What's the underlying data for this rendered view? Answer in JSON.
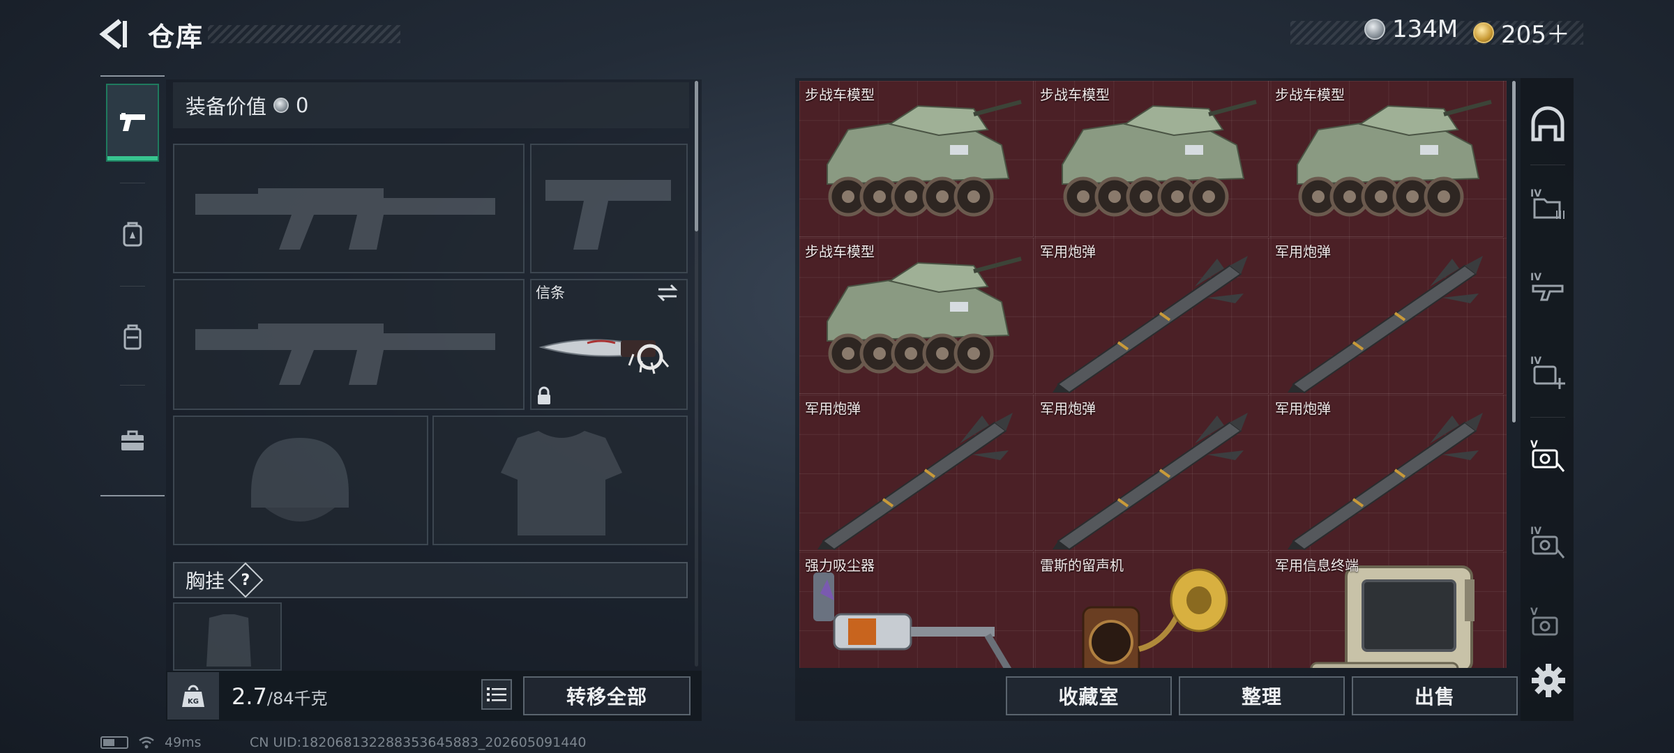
{
  "header": {
    "title": "仓库",
    "currency": [
      {
        "icon": "silver-coin-icon",
        "value": "134M"
      },
      {
        "icon": "gold-coin-icon",
        "value": "205＋"
      }
    ]
  },
  "left_rail": {
    "tabs": [
      {
        "icon": "pistol-icon",
        "active": true
      },
      {
        "icon": "backpack-icon",
        "active": false
      },
      {
        "icon": "rig-icon",
        "active": false
      },
      {
        "icon": "toolbox-icon",
        "active": false
      }
    ]
  },
  "loadout": {
    "value_label": "装备价值",
    "value": "0",
    "melee_label": "信条",
    "chest_label": "胸挂",
    "help": "?"
  },
  "footer_left": {
    "weight_current": "2.7",
    "weight_max": "/84千克",
    "weight_icon_text": "KG",
    "transfer_all": "转移全部"
  },
  "storage": {
    "items": [
      {
        "name": "步战车模型",
        "kind": "vehicle"
      },
      {
        "name": "步战车模型",
        "kind": "vehicle"
      },
      {
        "name": "步战车模型",
        "kind": "vehicle"
      },
      {
        "name": "步战车模型",
        "kind": "vehicle"
      },
      {
        "name": "军用炮弹",
        "kind": "missile"
      },
      {
        "name": "军用炮弹",
        "kind": "missile"
      },
      {
        "name": "军用炮弹",
        "kind": "missile"
      },
      {
        "name": "军用炮弹",
        "kind": "missile"
      },
      {
        "name": "军用炮弹",
        "kind": "missile"
      },
      {
        "name": "强力吸尘器",
        "kind": "vacuum"
      },
      {
        "name": "雷斯的留声机",
        "kind": "gramophone"
      },
      {
        "name": "军用信息终端",
        "kind": "terminal"
      }
    ],
    "cell_color": "#4b2026"
  },
  "footer_right": {
    "collection": "收藏室",
    "sort": "整理",
    "sell": "出售"
  },
  "status": {
    "ping": "49ms",
    "uid": "CN UID:18206813228835364588​3_202605091440"
  },
  "colors": {
    "accent_green": "#38c590",
    "background": "#232c38"
  }
}
